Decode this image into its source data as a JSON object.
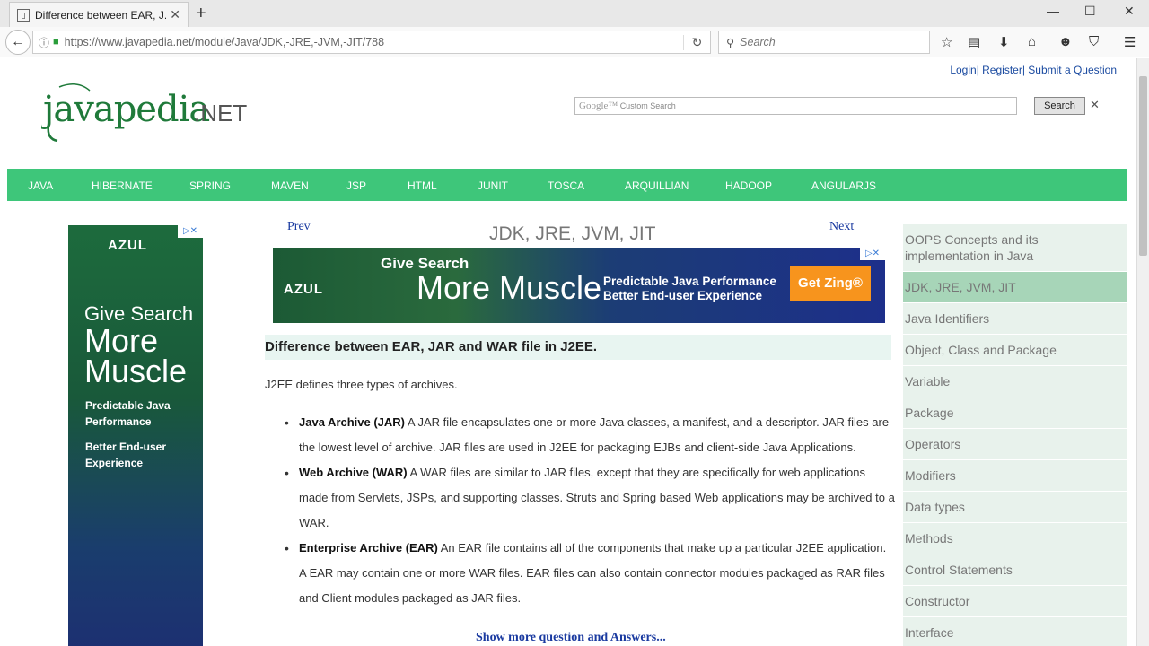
{
  "browser": {
    "tab_title": "Difference between EAR, J...",
    "favicon_glyph": "📖",
    "tab_close": "✕",
    "new_tab": "+",
    "window_controls": [
      "—",
      "☐",
      "✕"
    ],
    "back": "←",
    "url": "https://www.javapedia.net/module/Java/JDK,-JRE,-JVM,-JIT/788",
    "search_placeholder": "Search",
    "reload": "↻"
  },
  "header": {
    "login": "Login",
    "register": "Register",
    "submit": "Submit a Question",
    "logo_text": "javapedia.NET",
    "google_label": "Google™",
    "custom_search": "Custom Search",
    "search_button": "Search",
    "search_close": "✕"
  },
  "menu": [
    "JAVA",
    "HIBERNATE",
    "SPRING",
    "MAVEN",
    "JSP",
    "HTML",
    "JUNIT",
    "TOSCA",
    "ARQUILLIAN",
    "HADOOP",
    "ANGULARJS"
  ],
  "side_ad": {
    "brand": "AZUL",
    "line1": "Give Search",
    "line2": "More Muscle",
    "line3": "Predictable Java Performance",
    "line4": "Better End-user Experience"
  },
  "content": {
    "prev": "Prev",
    "next": "Next",
    "title": "JDK, JRE, JVM, JIT",
    "banner": {
      "brand": "AZUL",
      "line1": "Give Search",
      "line2": "More Muscle",
      "line3": "Predictable Java Performance",
      "line4": "Better End-user Experience",
      "cta": "Get Zing®"
    },
    "question": "Difference between EAR, JAR and WAR file in J2EE.",
    "intro": "J2EE defines three types of archives.",
    "items": [
      {
        "term": "Java Archive (JAR)",
        "text": " A JAR file encapsulates one or more Java classes, a manifest, and a descriptor. JAR files are the lowest level of archive. JAR files are used in J2EE for packaging EJBs and client-side Java Applications."
      },
      {
        "term": "Web Archive (WAR)",
        "text": " A WAR files are similar to JAR files, except that they are specifically for web applications made from Servlets, JSPs, and supporting classes. Struts and Spring based Web applications may be archived to a WAR."
      },
      {
        "term": "Enterprise Archive (EAR)",
        "text": " An EAR file contains all of the components that make up a particular J2EE application. A EAR may contain one or more WAR files. EAR files can also contain connector modules packaged as RAR files and Client modules packaged as JAR files."
      }
    ],
    "show_more": "Show more question and Answers..."
  },
  "sidebar": [
    "OOPS Concepts and its implementation in Java",
    "JDK, JRE, JVM, JIT",
    "Java Identifiers",
    "Object, Class and Package",
    "Variable",
    "Package",
    "Operators",
    "Modifiers",
    "Data types",
    "Methods",
    "Control Statements",
    "Constructor",
    "Interface"
  ],
  "sidebar_active": 1,
  "colors": {
    "menu_bg": "#3ec67a",
    "link": "#1a3aa0",
    "cta": "#f7941d"
  }
}
